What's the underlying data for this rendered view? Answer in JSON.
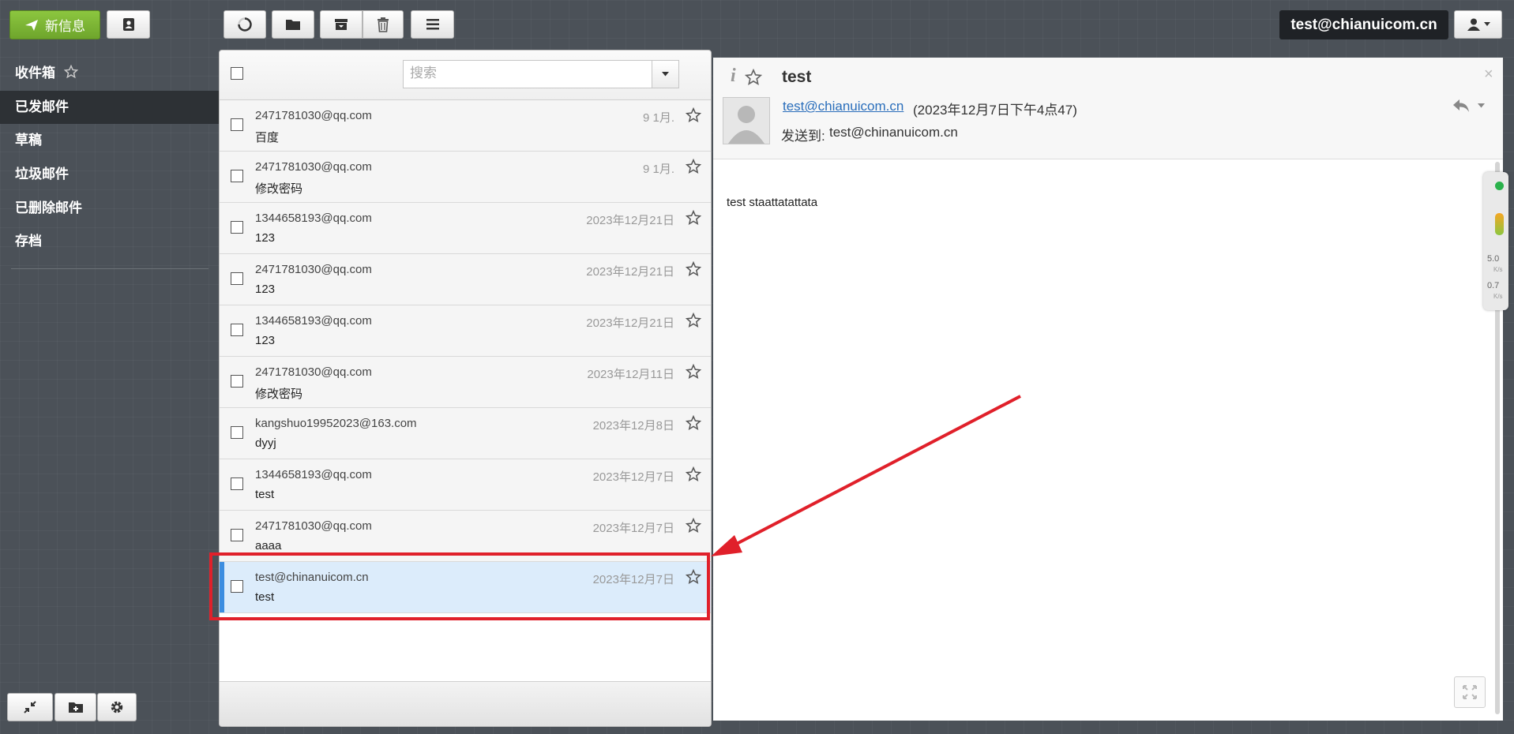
{
  "toolbar": {
    "compose_label": "新信息",
    "user_email": "test@chianuicom.cn"
  },
  "sidebar": {
    "folders": [
      {
        "label": "收件箱"
      },
      {
        "label": "已发邮件"
      },
      {
        "label": "草稿"
      },
      {
        "label": "垃圾邮件"
      },
      {
        "label": "已删除邮件"
      },
      {
        "label": "存档"
      }
    ],
    "active_folder": "已发邮件"
  },
  "list": {
    "search_placeholder": "搜索",
    "messages": [
      {
        "from": "2471781030@qq.com",
        "subject": "百度",
        "date": "9 1月."
      },
      {
        "from": "2471781030@qq.com",
        "subject": "修改密码",
        "date": "9 1月."
      },
      {
        "from": "1344658193@qq.com",
        "subject": "123",
        "date": "2023年12月21日"
      },
      {
        "from": "2471781030@qq.com",
        "subject": "123",
        "date": "2023年12月21日"
      },
      {
        "from": "1344658193@qq.com",
        "subject": "123",
        "date": "2023年12月21日"
      },
      {
        "from": "2471781030@qq.com",
        "subject": "修改密码",
        "date": "2023年12月11日"
      },
      {
        "from": "kangshuo19952023@163.com",
        "subject": "dyyj",
        "date": "2023年12月8日"
      },
      {
        "from": "1344658193@qq.com",
        "subject": "test",
        "date": "2023年12月7日"
      },
      {
        "from": "2471781030@qq.com",
        "subject": "aaaa",
        "date": "2023年12月7日"
      },
      {
        "from": "test@chinanuicom.cn",
        "subject": "test",
        "date": "2023年12月7日",
        "selected": true
      }
    ]
  },
  "preview": {
    "subject": "test",
    "from_link": "test@chianuicom.cn",
    "sent_time": "(2023年12月7日下午4点47)",
    "to_label": "发送到:",
    "to_address": "test@chinanuicom.cn",
    "body": "test staattatattata"
  },
  "speed_widget": {
    "up_value": "5.0",
    "down_value": "0.7",
    "unit": "K/s"
  },
  "colors": {
    "compose_green": "#7cb936",
    "selected_row": "#dcecfb",
    "selected_bar": "#3c8de0",
    "annotation_red": "#e0202a",
    "link_blue": "#2a6ebb"
  }
}
